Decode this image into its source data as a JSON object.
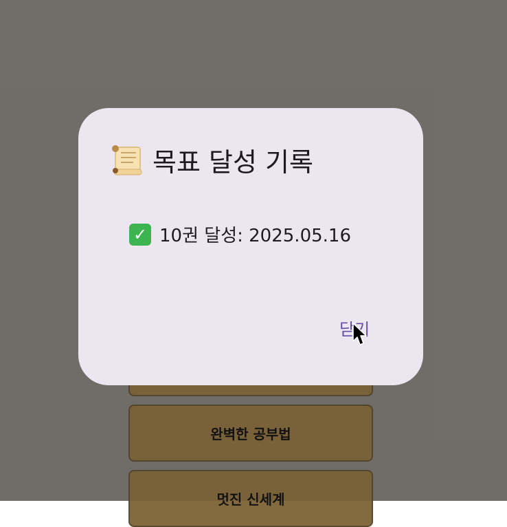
{
  "background_buttons": {
    "top_label": "",
    "book2_label": "완벽한 공부법",
    "book3_label": "멋진 신세계"
  },
  "dialog": {
    "title_icon": "scroll-icon",
    "title": "목표 달성 기록",
    "record_icon": "check-icon",
    "record_text": "10권 달성: 2025.05.16",
    "close_label": "닫기"
  },
  "colors": {
    "scrim": "#7a7772",
    "dialog_bg": "#ece6f0",
    "button_bg": "#846a3f",
    "accent": "#6a4fa8",
    "check": "#3cb44f"
  }
}
